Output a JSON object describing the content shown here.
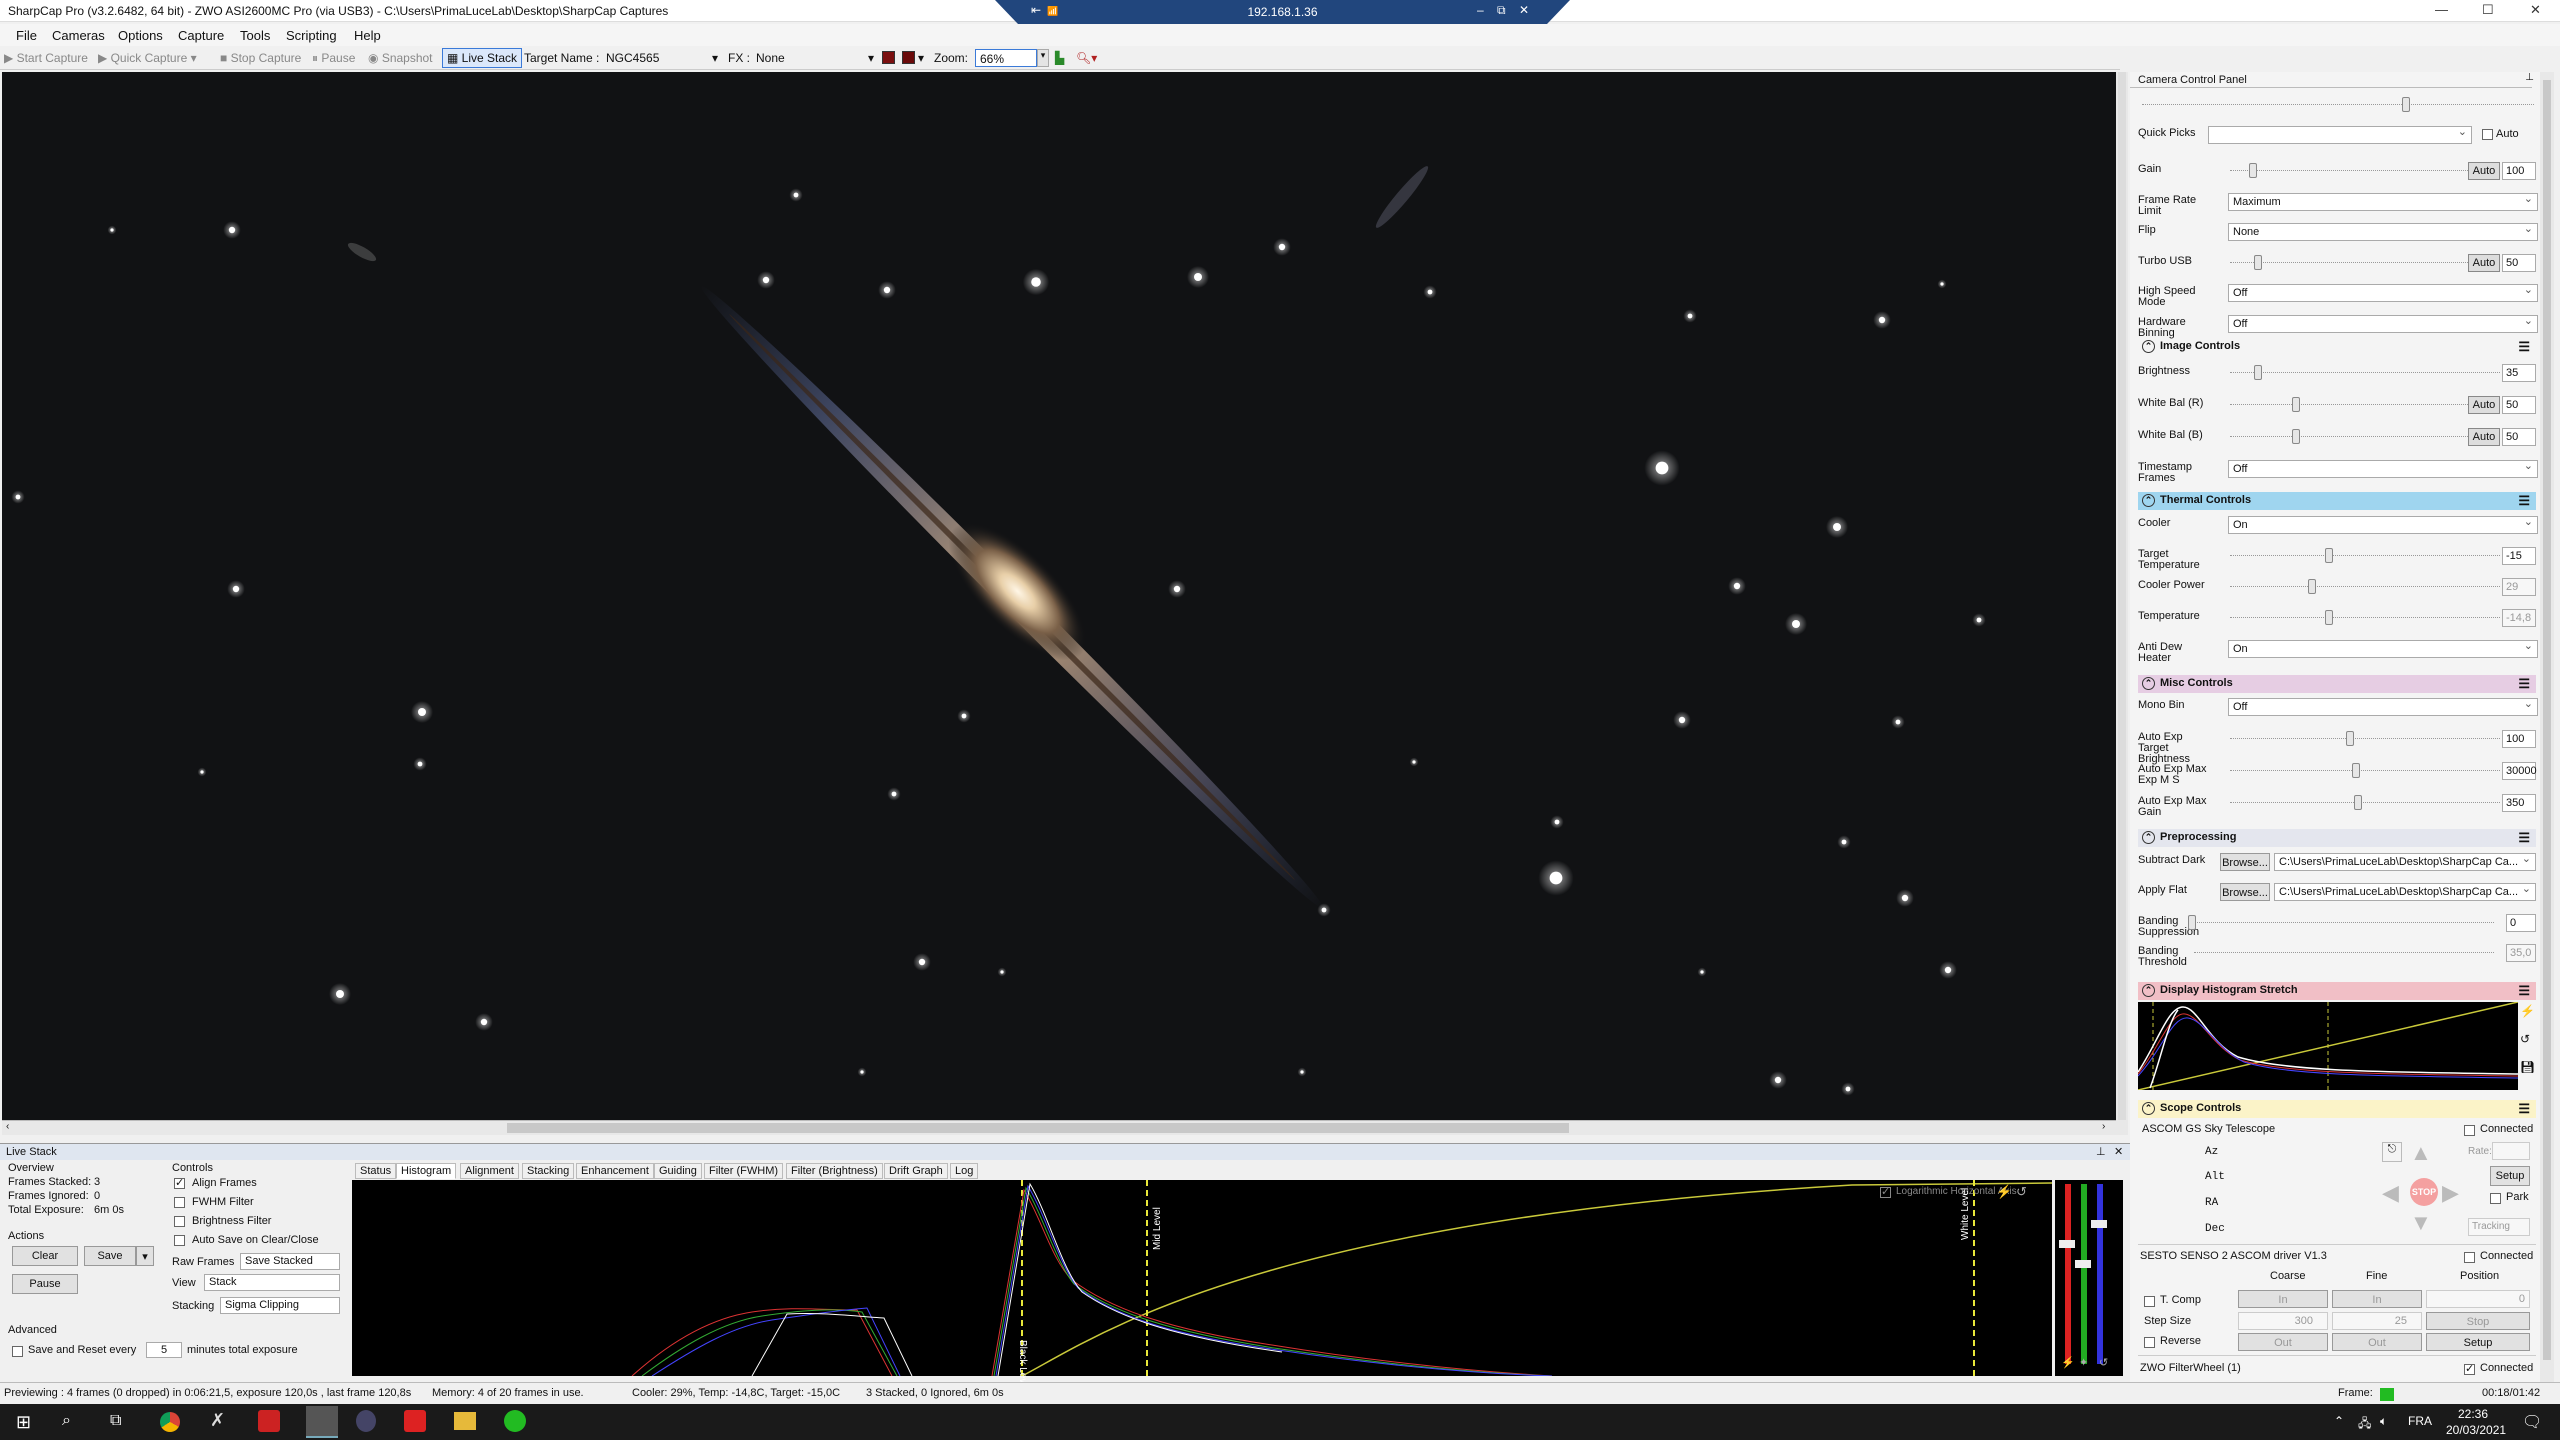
{
  "window": {
    "title": "SharpCap Pro (v3.2.6482, 64 bit) - ZWO ASI2600MC Pro (via USB3) - C:\\Users\\PrimaLuceLab\\Desktop\\SharpCap Captures",
    "minimize": "—",
    "maximize": "☐",
    "close": "✕"
  },
  "remote": {
    "ip": "192.168.1.36",
    "pin": "⇤",
    "signal": "📶",
    "min": "–",
    "max": "⧉",
    "close": "✕"
  },
  "menu": [
    "File",
    "Cameras",
    "Options",
    "Capture",
    "Tools",
    "Scripting",
    "Help"
  ],
  "toolbar": {
    "start_capture": "Start Capture",
    "quick_capture": "Quick Capture",
    "stop_capture": "Stop Capture",
    "pause": "Pause",
    "snapshot": "Snapshot",
    "live_stack": "Live Stack",
    "target_label": "Target Name :",
    "target_value": "NGC4565",
    "fx_label": "FX :",
    "fx_value": "None",
    "zoom_label": "Zoom:",
    "zoom_value": "66%"
  },
  "camera_panel": {
    "title": "Camera Control Panel",
    "quick_picks": "Quick Picks",
    "auto": "Auto",
    "rows": [
      {
        "label": "Gain",
        "type": "slider",
        "auto": "Auto",
        "value": "100",
        "pos": 0.08
      },
      {
        "label": "Frame Rate\nLimit",
        "type": "select",
        "value": "Maximum"
      },
      {
        "label": "Flip",
        "type": "select",
        "value": "None"
      },
      {
        "label": "Turbo USB",
        "type": "slider",
        "auto": "Auto",
        "value": "50",
        "pos": 0.1
      },
      {
        "label": "High Speed\nMode",
        "type": "select",
        "value": "Off"
      },
      {
        "label": "Hardware\nBinning",
        "type": "select",
        "value": "Off"
      }
    ],
    "image_controls": {
      "title": "Image Controls",
      "rows": [
        {
          "label": "Brightness",
          "type": "slider",
          "value": "35",
          "pos": 0.09
        },
        {
          "label": "White Bal (R)",
          "type": "slider",
          "auto": "Auto",
          "value": "50",
          "pos": 0.26
        },
        {
          "label": "White Bal (B)",
          "type": "slider",
          "auto": "Auto",
          "value": "50",
          "pos": 0.26
        },
        {
          "label": "Timestamp\nFrames",
          "type": "select",
          "value": "Off"
        }
      ]
    },
    "thermal_controls": {
      "title": "Thermal Controls",
      "rows": [
        {
          "label": "Cooler",
          "type": "select",
          "value": "On"
        },
        {
          "label": "Target\nTemperature",
          "type": "slider",
          "value": "-15",
          "pos": 0.35
        },
        {
          "label": "Cooler Power",
          "type": "slider",
          "value": "29",
          "dis": true,
          "pos": 0.29
        },
        {
          "label": "Temperature",
          "type": "slider",
          "value": "-14,8",
          "dis": true,
          "pos": 0.35
        },
        {
          "label": "Anti Dew Heater",
          "type": "select",
          "value": "On"
        }
      ]
    },
    "misc_controls": {
      "title": "Misc Controls",
      "rows": [
        {
          "label": "Mono Bin",
          "type": "select",
          "value": "Off"
        },
        {
          "label": "Auto Exp Target\nBrightness",
          "type": "slider",
          "value": "100",
          "pos": 0.43
        },
        {
          "label": "Auto Exp Max\nExp M S",
          "type": "slider",
          "value": "30000",
          "pos": 0.45
        },
        {
          "label": "Auto Exp Max\nGain",
          "type": "slider",
          "value": "350",
          "pos": 0.46
        }
      ]
    },
    "preprocessing": {
      "title": "Preprocessing",
      "browse": "Browse...",
      "subtract_dark_label": "Subtract Dark",
      "subtract_dark_path": "C:\\Users\\PrimaLuceLab\\Desktop\\SharpCap Ca...",
      "apply_flat_label": "Apply Flat",
      "apply_flat_path": "C:\\Users\\PrimaLuceLab\\Desktop\\SharpCap Ca...",
      "banding_supp_label": "Banding\nSuppression",
      "banding_supp_value": "0",
      "banding_thr_label": "Banding\nThreshold",
      "banding_thr_value": "35,0"
    },
    "histogram_stretch": {
      "title": "Display Histogram Stretch"
    },
    "scope": {
      "title": "Scope Controls",
      "scope_name": "ASCOM GS Sky Telescope",
      "connected": "Connected",
      "az": "Az",
      "alt": "Alt",
      "ra": "RA",
      "dec": "Dec",
      "rate": "Rate:",
      "setup": "Setup",
      "park": "Park",
      "tracking": "Tracking",
      "stop": "STOP"
    },
    "focuser": {
      "name": "SESTO SENSO 2 ASCOM driver V1.3",
      "connected": "Connected",
      "coarse": "Coarse",
      "fine": "Fine",
      "position": "Position",
      "t_comp": "T. Comp",
      "in": "In",
      "pos_value": "0",
      "step_size": "Step Size",
      "coarse_step": "300",
      "fine_step": "25",
      "stop": "Stop",
      "reverse": "Reverse",
      "out": "Out",
      "setup": "Setup"
    },
    "filterwheel": {
      "name": "ZWO FilterWheel (1)",
      "connected": "Connected"
    }
  },
  "livestack": {
    "title": "Live Stack",
    "overview": "Overview",
    "frames_stacked_label": "Frames Stacked:",
    "frames_stacked": "3",
    "frames_ignored_label": "Frames Ignored:",
    "frames_ignored": "0",
    "total_exposure_label": "Total Exposure:",
    "total_exposure": "6m 0s",
    "actions": "Actions",
    "clear": "Clear",
    "save": "Save",
    "pause": "Pause",
    "advanced": "Advanced",
    "save_reset_label": "Save and Reset every",
    "save_reset_value": "5",
    "save_reset_suffix": "minutes total exposure",
    "controls": "Controls",
    "align_frames": "Align Frames",
    "fwhm_filter": "FWHM Filter",
    "brightness_filter": "Brightness Filter",
    "auto_save": "Auto Save on Clear/Close",
    "raw_frames_label": "Raw Frames",
    "raw_frames_value": "Save Stacked",
    "view_label": "View",
    "view_value": "Stack",
    "stacking_label": "Stacking",
    "stacking_value": "Sigma Clipping",
    "tabs": [
      "Status",
      "Histogram",
      "Alignment",
      "Stacking",
      "Enhancement",
      "Guiding",
      "Filter (FWHM)",
      "Filter (Brightness)",
      "Drift Graph",
      "Log"
    ],
    "log_horiz": "Logarithmic Horizontal Axis",
    "black_level": "Black Level",
    "mid_level": "Mid Level",
    "white_level": "White Level"
  },
  "status": {
    "preview": "Previewing : 4 frames (0 dropped) in 0:06:21,5, exposure 120,0s , last frame 120,8s",
    "memory": "Memory: 4 of 20 frames in use.",
    "cooler": "Cooler: 29%, Temp: -14,8C, Target: -15,0C",
    "stack": "3 Stacked, 0 Ignored, 6m 0s",
    "frame_label": "Frame:",
    "elapsed": "00:18/01:42"
  },
  "taskbar": {
    "lang": "FRA",
    "time": "22:36",
    "date": "20/03/2021"
  }
}
